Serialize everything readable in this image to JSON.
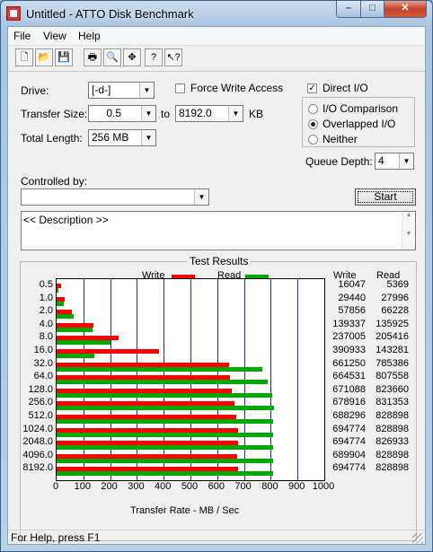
{
  "window": {
    "title": "Untitled - ATTO Disk Benchmark",
    "min_glyph": "–",
    "max_glyph": "□",
    "close_glyph": "✕"
  },
  "menu": [
    "File",
    "View",
    "Help"
  ],
  "toolbar": [
    "new-icon",
    "open-icon",
    "save-icon",
    "print-icon",
    "print-preview-icon",
    "move-icon",
    "help-icon",
    "context-help-icon"
  ],
  "form": {
    "drive_label": "Drive:",
    "drive_value": "[-d-]",
    "force_write_label": "Force Write Access",
    "direct_io_label": "Direct I/O",
    "transfer_size_label": "Transfer Size:",
    "transfer_from": "0.5",
    "to_label": "to",
    "transfer_to": "8192.0",
    "kb_label": "KB",
    "io_comparison_label": "I/O Comparison",
    "overlapped_io_label": "Overlapped I/O",
    "neither_label": "Neither",
    "total_length_label": "Total Length:",
    "total_length_value": "256 MB",
    "queue_depth_label": "Queue Depth:",
    "queue_depth_value": "4",
    "controlled_by_label": "Controlled by:",
    "controlled_by_value": "",
    "start_label": "Start",
    "description": "<< Description >>",
    "force_write_checked": false,
    "direct_io_checked": true,
    "io_mode_selected": "Overlapped I/O"
  },
  "results": {
    "title": "Test Results",
    "legend_write": "Write",
    "legend_read": "Read",
    "col_write": "Write",
    "col_read": "Read",
    "xlabel": "Transfer Rate - MB / Sec"
  },
  "chart_data": {
    "type": "bar",
    "title": "Test Results",
    "xlabel": "Transfer Rate - MB / Sec",
    "xlim": [
      0,
      1000
    ],
    "xticks": [
      0,
      100,
      200,
      300,
      400,
      500,
      600,
      700,
      800,
      900,
      1000
    ],
    "categories": [
      "0.5",
      "1.0",
      "2.0",
      "4.0",
      "8.0",
      "16.0",
      "32.0",
      "64.0",
      "128.0",
      "256.0",
      "512.0",
      "1024.0",
      "2048.0",
      "4096.0",
      "8192.0"
    ],
    "series": [
      {
        "name": "Write",
        "color": "#ff0000",
        "kb_values": [
          16047,
          29440,
          57856,
          139337,
          237005,
          390933,
          661250,
          664531,
          671088,
          678916,
          688296,
          694774,
          694774,
          689904,
          694774
        ]
      },
      {
        "name": "Read",
        "color": "#00aa00",
        "kb_values": [
          5369,
          27996,
          66228,
          135925,
          205416,
          143281,
          785386,
          807558,
          823660,
          831353,
          828898,
          828898,
          826933,
          828898,
          828898
        ]
      }
    ]
  },
  "status": {
    "text": "For Help, press F1"
  }
}
